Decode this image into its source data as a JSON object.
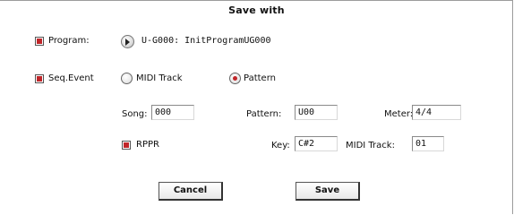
{
  "dialog": {
    "title": "Save with"
  },
  "program": {
    "label": "Program:",
    "checked": true,
    "value": "U-G000: InitProgramUG000"
  },
  "seq_event": {
    "label": "Seq.Event",
    "checked": true,
    "radio_midi_track": "MIDI Track",
    "radio_pattern": "Pattern",
    "selected": "Pattern"
  },
  "pattern_row": {
    "song_label": "Song:",
    "song_value": "000",
    "pattern_label": "Pattern:",
    "pattern_value": "U00",
    "meter_label": "Meter:",
    "meter_value": "4/4"
  },
  "rppr_row": {
    "rppr_label": "RPPR",
    "rppr_checked": true,
    "key_label": "Key:",
    "key_value": "C#2",
    "midi_track_label": "MIDI Track:",
    "midi_track_value": "01"
  },
  "buttons": {
    "cancel": "Cancel",
    "save": "Save"
  },
  "colors": {
    "accent": "#c0262a"
  }
}
